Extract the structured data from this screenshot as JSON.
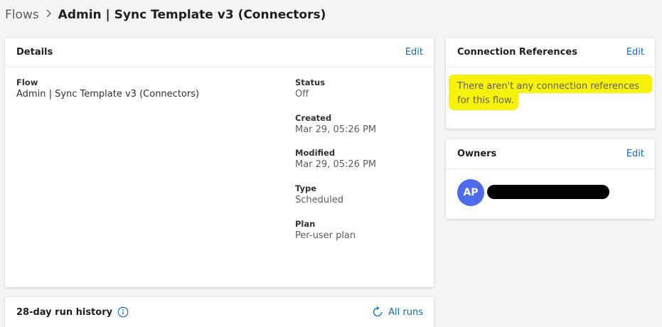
{
  "breadcrumb": {
    "root": "Flows",
    "separator": ">",
    "current": "Admin | Sync Template v3 (Connectors)"
  },
  "details": {
    "title": "Details",
    "edit_label": "Edit",
    "flow": {
      "label": "Flow",
      "value": "Admin | Sync Template v3 (Connectors)"
    },
    "status": {
      "label": "Status",
      "value": "Off"
    },
    "created": {
      "label": "Created",
      "value": "Mar 29, 05:26 PM"
    },
    "modified": {
      "label": "Modified",
      "value": "Mar 29, 05:26 PM"
    },
    "type": {
      "label": "Type",
      "value": "Scheduled"
    },
    "plan": {
      "label": "Plan",
      "value": "Per-user plan"
    }
  },
  "connection_references": {
    "title": "Connection References",
    "edit_label": "Edit",
    "empty_message": "There aren't any connection references for this flow.",
    "highlight_color": "#f7f20a"
  },
  "owners": {
    "title": "Owners",
    "edit_label": "Edit",
    "items": [
      {
        "initials": "AP",
        "avatar_color": "#4f6bed"
      }
    ]
  },
  "run_history": {
    "title": "28-day run history",
    "all_runs_label": "All runs",
    "info_icon": "info-icon",
    "refresh_icon": "refresh-icon"
  },
  "colors": {
    "link": "#0f6cbd",
    "background": "#f4f4f4"
  }
}
